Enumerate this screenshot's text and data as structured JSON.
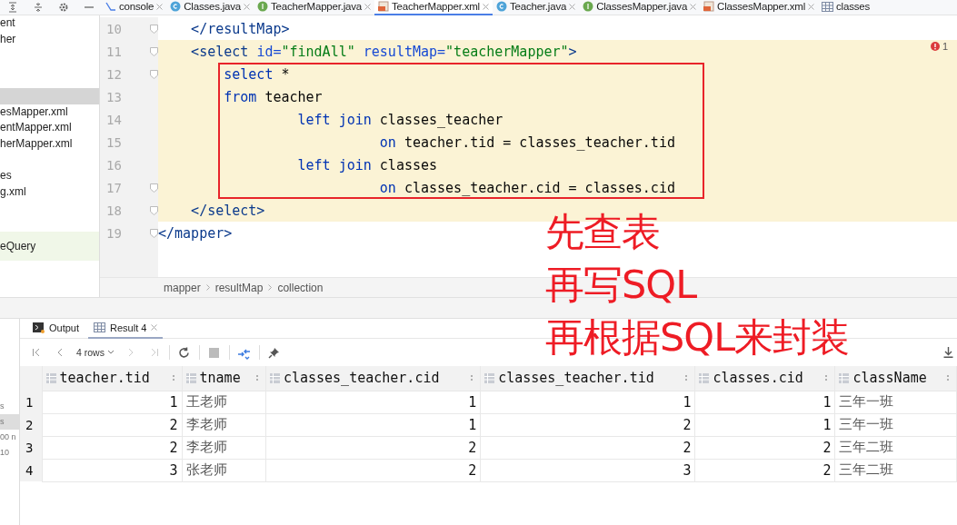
{
  "sidebar_toolbar": [
    {
      "kind": "collapse"
    },
    {
      "kind": "expand"
    },
    {
      "kind": "settings"
    },
    {
      "kind": "minimize"
    }
  ],
  "editor_tabs": [
    {
      "label": "console",
      "kind": "console",
      "selected": false
    },
    {
      "label": "Classes.java",
      "kind": "class",
      "selected": false
    },
    {
      "label": "TeacherMapper.java",
      "kind": "interface",
      "selected": false
    },
    {
      "label": "TeacherMapper.xml",
      "kind": "xml",
      "selected": true
    },
    {
      "label": "Teacher.java",
      "kind": "class",
      "selected": false
    },
    {
      "label": "ClassesMapper.java",
      "kind": "interface",
      "selected": false
    },
    {
      "label": "ClassesMapper.xml",
      "kind": "xml",
      "selected": false
    },
    {
      "label": "classes",
      "kind": "table",
      "selected": false
    }
  ],
  "project_tree": [
    {
      "label": "ent",
      "selected": false,
      "highlighted": false
    },
    {
      "label": "her",
      "selected": false,
      "highlighted": false
    },
    {
      "selected": true,
      "highlighted": false
    },
    {
      "label": "esMapper.xml",
      "selected": false,
      "highlighted": false
    },
    {
      "label": "entMapper.xml",
      "selected": false,
      "highlighted": false
    },
    {
      "label": "herMapper.xml",
      "selected": false,
      "highlighted": false
    },
    {
      "label": "es",
      "selected": false,
      "highlighted": false
    },
    {
      "label": "g.xml",
      "selected": false,
      "highlighted": false
    },
    {
      "label": "eQuery",
      "selected": false,
      "highlighted": true
    }
  ],
  "problems": {
    "count": "1"
  },
  "code_lines": [
    {
      "number": "10",
      "highlighted": false,
      "boxed": false,
      "fold": true,
      "tokens": [
        {
          "kind": "tag",
          "text": "    </resultMap>"
        }
      ]
    },
    {
      "number": "11",
      "highlighted": true,
      "boxed": false,
      "fold": true,
      "tokens": [
        {
          "kind": "tag",
          "text": "    <select "
        },
        {
          "kind": "attr",
          "text": "id="
        },
        {
          "kind": "value",
          "text": "\"findAll\""
        },
        {
          "kind": "attr",
          "text": " resultMap="
        },
        {
          "kind": "value",
          "text": "\"teacherMapper\""
        },
        {
          "kind": "tag",
          "text": ">"
        }
      ]
    },
    {
      "number": "12",
      "highlighted": true,
      "boxed": true,
      "fold": true,
      "tokens": [
        {
          "kind": "keyword",
          "text": "        select "
        },
        {
          "kind": "plain",
          "text": "*"
        }
      ]
    },
    {
      "number": "13",
      "highlighted": true,
      "boxed": true,
      "fold": false,
      "tokens": [
        {
          "kind": "keyword",
          "text": "        from "
        },
        {
          "kind": "plain",
          "text": "teacher"
        }
      ]
    },
    {
      "number": "14",
      "highlighted": true,
      "boxed": true,
      "fold": false,
      "tokens": [
        {
          "kind": "keyword",
          "text": "                 left join "
        },
        {
          "kind": "plain",
          "text": "classes_teacher"
        }
      ]
    },
    {
      "number": "15",
      "highlighted": true,
      "boxed": true,
      "fold": false,
      "tokens": [
        {
          "kind": "keyword",
          "text": "                           on "
        },
        {
          "kind": "plain",
          "text": "teacher.tid = classes_teacher.tid"
        }
      ]
    },
    {
      "number": "16",
      "highlighted": true,
      "boxed": true,
      "fold": false,
      "tokens": [
        {
          "kind": "keyword",
          "text": "                 left join "
        },
        {
          "kind": "plain",
          "text": "classes"
        }
      ]
    },
    {
      "number": "17",
      "highlighted": true,
      "boxed": true,
      "fold": true,
      "tokens": [
        {
          "kind": "keyword",
          "text": "                           on "
        },
        {
          "kind": "plain",
          "text": "classes_teacher.cid = classes.cid"
        }
      ]
    },
    {
      "number": "18",
      "highlighted": true,
      "boxed": false,
      "fold": true,
      "tokens": [
        {
          "kind": "tag",
          "text": "    </select>"
        }
      ]
    },
    {
      "number": "19",
      "highlighted": false,
      "boxed": false,
      "fold": true,
      "tokens": [
        {
          "kind": "tag",
          "text": "</mapper>"
        }
      ]
    }
  ],
  "breadcrumb": [
    "mapper",
    "resultMap",
    "collection"
  ],
  "annotation": [
    "先查表",
    "再写SQL",
    "再根据SQL来封装"
  ],
  "bottom_sidebar": [
    {
      "label": "s",
      "selected": false
    },
    {
      "label": "s",
      "selected": true
    },
    {
      "label": "00 n",
      "selected": false
    },
    {
      "label": "10",
      "selected": false
    }
  ],
  "panel_tabs": [
    {
      "label": "Output",
      "kind": "output",
      "selected": false,
      "closable": false
    },
    {
      "label": "Result 4",
      "kind": "table",
      "selected": true,
      "closable": true
    }
  ],
  "result_toolbar": {
    "rows": "4 rows"
  },
  "table": {
    "columns": [
      {
        "name": "teacher.tid",
        "kind": "number"
      },
      {
        "name": "tname",
        "kind": "text"
      },
      {
        "name": "classes_teacher.cid",
        "kind": "number"
      },
      {
        "name": "classes_teacher.tid",
        "kind": "number"
      },
      {
        "name": "classes.cid",
        "kind": "number"
      },
      {
        "name": "className",
        "kind": "text"
      }
    ],
    "rows": [
      {
        "number": "1",
        "cells": [
          "1",
          "王老师",
          "1",
          "1",
          "1",
          "三年一班"
        ]
      },
      {
        "number": "2",
        "cells": [
          "2",
          "李老师",
          "1",
          "2",
          "1",
          "三年一班"
        ]
      },
      {
        "number": "3",
        "cells": [
          "2",
          "李老师",
          "2",
          "2",
          "2",
          "三年二班"
        ]
      },
      {
        "number": "4",
        "cells": [
          "3",
          "张老师",
          "2",
          "3",
          "2",
          "三年二班"
        ]
      }
    ]
  }
}
